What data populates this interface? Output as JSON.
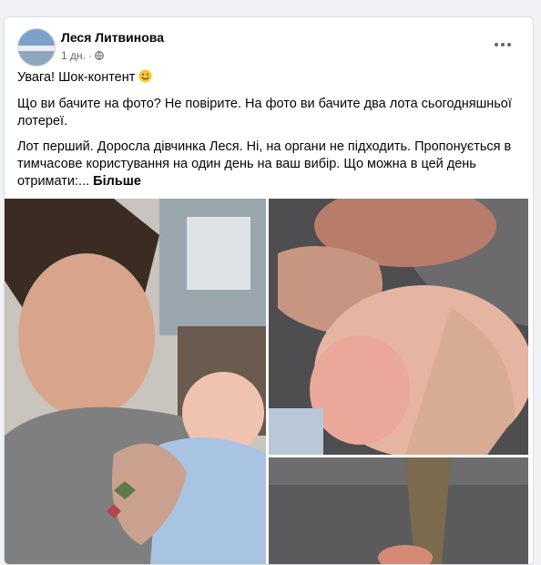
{
  "post": {
    "author": "Леся Литвинова",
    "time": "1 дн.",
    "visibility_icon": "globe-icon",
    "paragraphs": {
      "p1": "Увага! Шок-контент",
      "p2": "Що ви бачите на фото? Не повірите. На фото ви бачите два лота сьогодняшньої лотереї.",
      "p3": "Лот перший. Доросла дівчинка Леся. Ні, на органи не підходить. Пропонується в тимчасове користування на один день на ваш вибір. Що можна в цей день отримати:..."
    },
    "see_more": "Більше",
    "photos_count_shown": 3
  },
  "colors": {
    "background": "#f0f2f5",
    "card": "#ffffff",
    "text": "#050505",
    "secondary": "#65676b"
  }
}
